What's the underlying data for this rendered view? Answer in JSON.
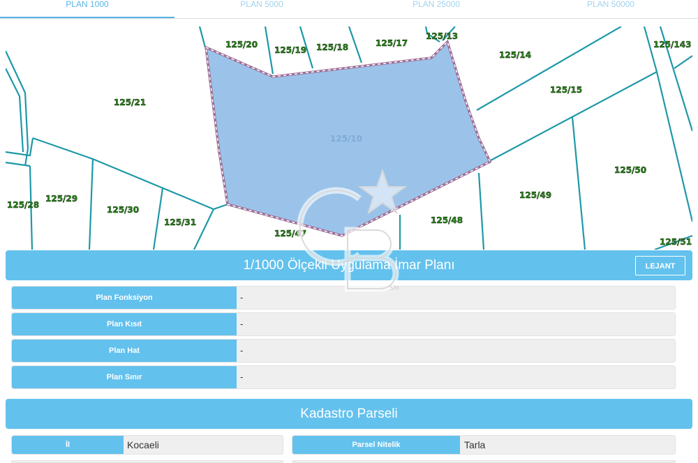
{
  "tabs": [
    {
      "label": "PLAN 1000",
      "active": true
    },
    {
      "label": "PLAN 5000",
      "active": false
    },
    {
      "label": "PLAN 25000",
      "active": false
    },
    {
      "label": "PLAN 50000",
      "active": false
    }
  ],
  "map": {
    "selected_parcel": "125/10",
    "parcels": [
      "125/20",
      "125/19",
      "125/18",
      "125/17",
      "125/13",
      "125/143",
      "125/14",
      "125/15",
      "125/21",
      "125/50",
      "125/49",
      "125/28",
      "125/29",
      "125/30",
      "125/31",
      "125/47",
      "125/48",
      "125/51"
    ],
    "colors": {
      "selected_fill": "#9bc3ea",
      "parcel_line": "#1e98a8",
      "selected_border": "#9c6f98"
    }
  },
  "plan_section": {
    "title": "1/1000 Ölçekli Uygulama İmar Planı",
    "legend_button": "LEJANT",
    "rows": [
      {
        "label": "Plan Fonksiyon",
        "value": "-"
      },
      {
        "label": "Plan Kısıt",
        "value": "-"
      },
      {
        "label": "Plan Hat",
        "value": "-"
      },
      {
        "label": "Plan Sınır",
        "value": "-"
      }
    ]
  },
  "cadastre_section": {
    "title": "Kadastro Parseli",
    "fields": [
      {
        "label": "İl",
        "value": "Kocaeli"
      },
      {
        "label": "Parsel Nitelik",
        "value": "Tarla"
      }
    ]
  },
  "watermark": {
    "icon": "cb-star-logo-icon",
    "mark": "SM"
  }
}
